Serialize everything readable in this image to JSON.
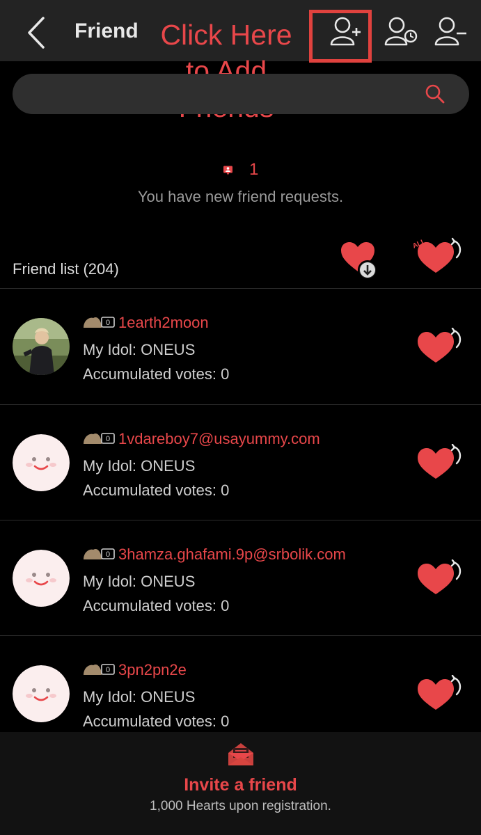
{
  "header": {
    "title": "Friend",
    "annotation_lines": [
      "Click Here",
      "to Add",
      "Friends"
    ]
  },
  "search": {
    "value": "",
    "placeholder": ""
  },
  "requests": {
    "count": "1",
    "message": "You have new friend requests."
  },
  "friend_list": {
    "title": "Friend list (204)",
    "all_label": "ALL",
    "items": [
      {
        "badge": "0",
        "username": "1earth2moon",
        "idol": "My Idol: ONEUS",
        "votes": "Accumulated votes: 0",
        "avatar": "photo"
      },
      {
        "badge": "0",
        "username": "1vdareboy7@usayummy.com",
        "idol": "My Idol: ONEUS",
        "votes": "Accumulated votes: 0",
        "avatar": "default-face"
      },
      {
        "badge": "0",
        "username": "3hamza.ghafami.9p@srbolik.com",
        "idol": "My Idol: ONEUS",
        "votes": "Accumulated votes: 0",
        "avatar": "default-face"
      },
      {
        "badge": "0",
        "username": "3pn2pn2e",
        "idol": "My Idol: ONEUS",
        "votes": "Accumulated votes: 0",
        "avatar": "default-face"
      }
    ]
  },
  "footer": {
    "invite_label": "Invite a friend",
    "invite_sub": "1,000 Hearts upon registration."
  },
  "colors": {
    "accent": "#e8474a",
    "header_bg": "#232323",
    "background": "#000000",
    "search_bg": "#2f2f2f"
  }
}
